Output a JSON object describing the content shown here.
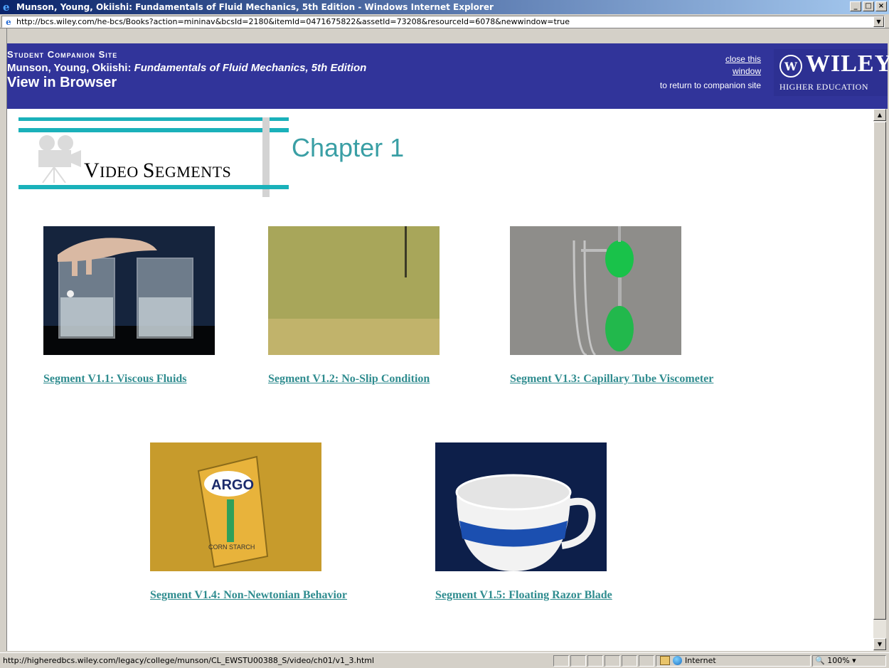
{
  "window": {
    "title": "Munson, Young, Okiishi: Fundamentals of Fluid Mechanics, 5th Edition - Windows Internet Explorer",
    "buttons": [
      "_",
      "□",
      "×"
    ]
  },
  "address": {
    "url": "http://bcs.wiley.com/he-bcs/Books?action=mininav&bcsId=2180&itemId=0471675822&assetId=73208&resourceId=6078&newwindow=true"
  },
  "banner": {
    "site_label": "Student Companion Site",
    "authors": "Munson, Young, Okiishi: ",
    "book_title": "Fundamentals of Fluid Mechanics, 5th Edition",
    "view_label": "View in Browser",
    "close_link": "close this window",
    "return_text": "to return to companion site",
    "logo_word": "WILEY",
    "logo_sub": "HIGHER EDUCATION"
  },
  "header": {
    "section_title_first": "V",
    "section_title_rest": "IDEO ",
    "section_title_second": "S",
    "section_title_rest2": "EGMENTS",
    "chapter": "Chapter 1"
  },
  "segments": [
    {
      "label": "Segment V1.1: Viscous Fluids"
    },
    {
      "label": "Segment V1.2: No-Slip Condition"
    },
    {
      "label": "Segment V1.3: Capillary Tube Viscometer"
    },
    {
      "label": "Segment V1.4: Non-Newtonian Behavior"
    },
    {
      "label": "Segment V1.5: Floating Razor Blade"
    }
  ],
  "thumbnail_text": {
    "argo": "ARGO",
    "corn_starch": "CORN STARCH"
  },
  "status": {
    "url": "http://higheredbcs.wiley.com/legacy/college/munson/CL_EWSTU00388_S/video/ch01/v1_3.html",
    "zone": "Internet",
    "zoom": "100%"
  },
  "colors": {
    "banner": "#31349a",
    "accent_teal": "#1ab1ba",
    "link": "#2f8c8f",
    "chapter": "#3a9fa5"
  }
}
